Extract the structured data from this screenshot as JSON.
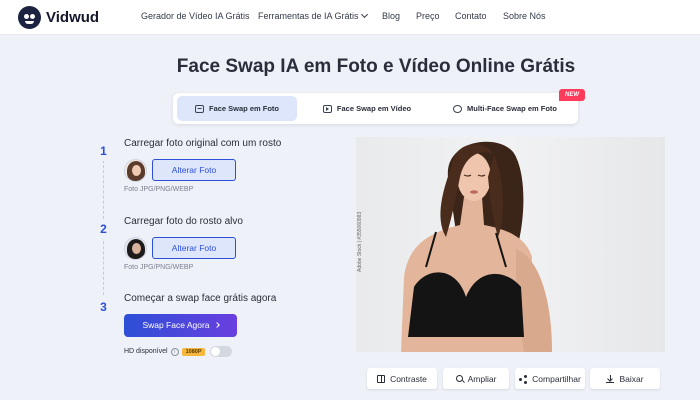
{
  "brand": {
    "name": "Vidwud"
  },
  "nav": {
    "items": [
      {
        "label": "Gerador de Vídeo IA Grátis"
      },
      {
        "label": "Ferramentas de IA Grátis",
        "has_dropdown": true
      },
      {
        "label": "Blog"
      },
      {
        "label": "Preço"
      },
      {
        "label": "Contato"
      },
      {
        "label": "Sobre Nós"
      }
    ]
  },
  "page": {
    "title": "Face Swap IA em Foto e Vídeo Online Grátis"
  },
  "tabs": [
    {
      "label": "Face Swap em Foto",
      "icon": "photo-icon",
      "active": true
    },
    {
      "label": "Face Swap em Vídeo",
      "icon": "video-icon",
      "active": false
    },
    {
      "label": "Multi-Face Swap em Foto",
      "icon": "multi-face-icon",
      "active": false,
      "badge": "NEW"
    }
  ],
  "steps": [
    {
      "number": "1",
      "title": "Carregar foto original com um rosto",
      "button": "Alterar Foto",
      "formats": "Foto JPG/PNG/WEBP"
    },
    {
      "number": "2",
      "title": "Carregar foto do rosto alvo",
      "button": "Alterar Foto",
      "formats": "Foto JPG/PNG/WEBP"
    },
    {
      "number": "3",
      "title": "Começar a swap face grátis agora",
      "button": "Swap Face Agora"
    }
  ],
  "hd": {
    "label": "HD disponível",
    "badge": "1080P",
    "enabled": false
  },
  "preview": {
    "watermark": "Adobe Stock | #355060983"
  },
  "actions": [
    {
      "label": "Contraste",
      "icon": "compare-icon"
    },
    {
      "label": "Ampliar",
      "icon": "zoom-icon"
    },
    {
      "label": "Compartilhar",
      "icon": "share-icon"
    },
    {
      "label": "Baixar",
      "icon": "download-icon"
    }
  ],
  "colors": {
    "primary": "#2d4fd6",
    "accent_gradient_end": "#6a3fe0",
    "new_badge": "#ff3b5c",
    "hd_badge": "#f6b73c",
    "page_bg": "#eef1f7"
  }
}
